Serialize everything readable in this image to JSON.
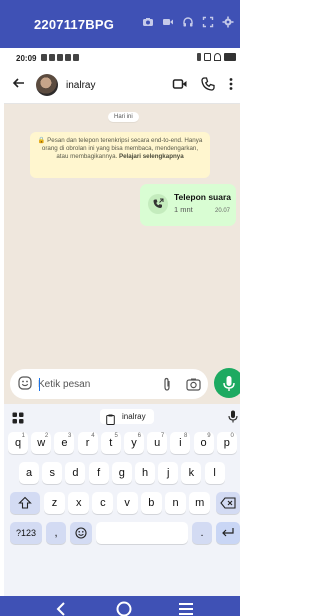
{
  "mirror": {
    "title": "2207117BPG",
    "icons": [
      "camera-icon",
      "video-icon",
      "headphones-icon",
      "fullscreen-icon",
      "settings-icon"
    ]
  },
  "status_bar": {
    "time": "20:09"
  },
  "header": {
    "contact_name": "inalray",
    "icons": [
      "back-arrow-icon",
      "video-call-icon",
      "voice-call-icon",
      "more-vertical-icon"
    ]
  },
  "chat": {
    "date_chip": "Hari ini",
    "encryption_notice": "Pesan dan telepon terenkripsi secara end-to-end. Hanya orang di obrolan ini yang bisa membaca, mendengarkan, atau membagikannya.",
    "encryption_link": "Pelajari selengkapnya",
    "call": {
      "title": "Telepon suara",
      "duration": "1 mnt",
      "time": "20.07"
    }
  },
  "composer": {
    "placeholder": "Ketik pesan",
    "icons": [
      "emoji-icon",
      "attach-icon",
      "camera-icon",
      "mic-icon"
    ]
  },
  "keyboard": {
    "suggestion": "inalray",
    "row1": [
      {
        "k": "q",
        "h": "1"
      },
      {
        "k": "w",
        "h": "2"
      },
      {
        "k": "e",
        "h": "3"
      },
      {
        "k": "r",
        "h": "4"
      },
      {
        "k": "t",
        "h": "5"
      },
      {
        "k": "y",
        "h": "6"
      },
      {
        "k": "u",
        "h": "7"
      },
      {
        "k": "i",
        "h": "8"
      },
      {
        "k": "o",
        "h": "9"
      },
      {
        "k": "p",
        "h": "0"
      }
    ],
    "row2": [
      "a",
      "s",
      "d",
      "f",
      "g",
      "h",
      "j",
      "k",
      "l"
    ],
    "row3": [
      "z",
      "x",
      "c",
      "v",
      "b",
      "n",
      "m"
    ],
    "symbols_label": "?123",
    "comma": ",",
    "period": ".",
    "icons": [
      "grid-icon",
      "clipboard-icon",
      "keyboard-mic-icon",
      "shift-icon",
      "backspace-icon",
      "emoji-key-icon",
      "enter-icon"
    ]
  },
  "colors": {
    "mirror_bar": "#3f51b5",
    "chat_bg": "#efe7dd",
    "outgoing_bubble": "#d9fdd3",
    "notice_bg": "#fff6cf",
    "accent_green": "#1daa61"
  }
}
